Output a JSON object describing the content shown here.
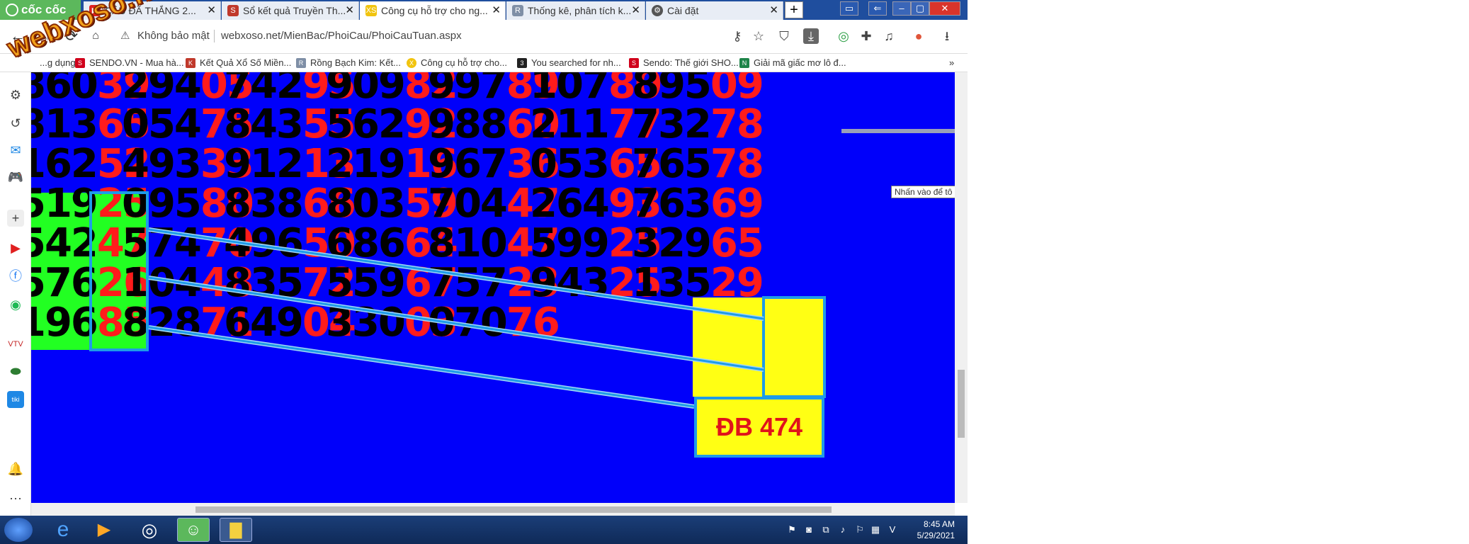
{
  "browser": {
    "brand": "cốc cốc",
    "tabs": [
      {
        "label": "CẦU ĐÃ THẮNG 2...",
        "icon_color": "#e02020"
      },
      {
        "label": "Sổ kết quả Truyền Th...",
        "icon_color": "#c0392b"
      },
      {
        "label": "Công cụ hỗ trợ cho ng...",
        "icon_color": "#f1c40f",
        "active": true
      },
      {
        "label": "Thống kê, phân tích k...",
        "icon_color": "#7f8fa6"
      },
      {
        "label": "Cài đặt",
        "icon_color": "#555555"
      }
    ],
    "security_label": "Không bảo mật",
    "url": "webxoso.net/MienBac/PhoiCau/PhoiCauTuan.aspx",
    "bookmarks": [
      {
        "label": "...g dụng",
        "color": "#888888"
      },
      {
        "label": "SENDO.VN - Mua hà...",
        "color": "#d0021b"
      },
      {
        "label": "Kết Quả Xổ Số Miền...",
        "color": "#c0392b"
      },
      {
        "label": "Rồng Bạch Kim: Kết...",
        "color": "#7f8fa6"
      },
      {
        "label": "Công cụ hỗ trợ cho...",
        "color": "#f1c40f"
      },
      {
        "label": "You searched for nh...",
        "color": "#222222"
      },
      {
        "label": "Sendo: Thế giới SHO...",
        "color": "#d0021b"
      },
      {
        "label": "Giải mã giấc mơ lô đ...",
        "color": "#1e8449"
      }
    ]
  },
  "watermark": "webxoso.net",
  "grid": {
    "rows": [
      [
        {
          "pre": "860",
          "suf": "39"
        },
        {
          "pre": "294",
          "suf": "05"
        },
        {
          "pre": "742",
          "suf": "95"
        },
        {
          "pre": "909",
          "suf": "82"
        },
        {
          "pre": "997",
          "suf": "89"
        },
        {
          "pre": "107",
          "suf": "80"
        },
        {
          "pre": "895",
          "suf": "09"
        }
      ],
      [
        {
          "pre": "813",
          "suf": "65"
        },
        {
          "pre": "054",
          "suf": "75"
        },
        {
          "pre": "843",
          "suf": "55"
        },
        {
          "pre": "562",
          "suf": "92"
        },
        {
          "pre": "988",
          "suf": "60"
        },
        {
          "pre": "211",
          "suf": "77"
        },
        {
          "pre": "732",
          "suf": "78"
        }
      ],
      [
        {
          "pre": "162",
          "suf": "52"
        },
        {
          "pre": "493",
          "suf": "33"
        },
        {
          "pre": "912",
          "suf": "13"
        },
        {
          "pre": "219",
          "suf": "16"
        },
        {
          "pre": "967",
          "suf": "36"
        },
        {
          "pre": "053",
          "suf": "65"
        },
        {
          "pre": "765",
          "suf": "78"
        }
      ],
      [
        {
          "pre": "519",
          "suf": "25"
        },
        {
          "pre": "095",
          "suf": "80"
        },
        {
          "pre": "838",
          "suf": "66"
        },
        {
          "pre": "803",
          "suf": "59"
        },
        {
          "pre": "704",
          "suf": "47"
        },
        {
          "pre": "264",
          "suf": "93"
        },
        {
          "pre": "763",
          "suf": "69"
        }
      ],
      [
        {
          "pre": "542",
          "suf": "47"
        },
        {
          "pre": "574",
          "suf": "70"
        },
        {
          "pre": "496",
          "suf": "50"
        },
        {
          "pre": "686",
          "suf": "64"
        },
        {
          "pre": "810",
          "suf": "47"
        },
        {
          "pre": "599",
          "suf": "25"
        },
        {
          "pre": "329",
          "suf": "65"
        }
      ],
      [
        {
          "pre": "576",
          "suf": "26"
        },
        {
          "pre": "104",
          "suf": "48"
        },
        {
          "pre": "835",
          "suf": "72"
        },
        {
          "pre": "559",
          "suf": "67"
        },
        {
          "pre": "757",
          "suf": "23"
        },
        {
          "pre": "943",
          "suf": "25"
        },
        {
          "pre": "135",
          "suf": "29"
        }
      ],
      [
        {
          "pre": "196",
          "suf": "85"
        },
        {
          "pre": "828",
          "suf": "71"
        },
        {
          "pre": "649",
          "suf": "04"
        },
        {
          "pre": "330",
          "suf": "03"
        },
        {
          "pre": "070",
          "suf": "76"
        }
      ]
    ]
  },
  "special_prize": "ĐB 474",
  "tooltip": "Nhấn vào để tô màu cho ô",
  "taskbar": {
    "time": "8:45 AM",
    "date": "5/29/2021"
  }
}
